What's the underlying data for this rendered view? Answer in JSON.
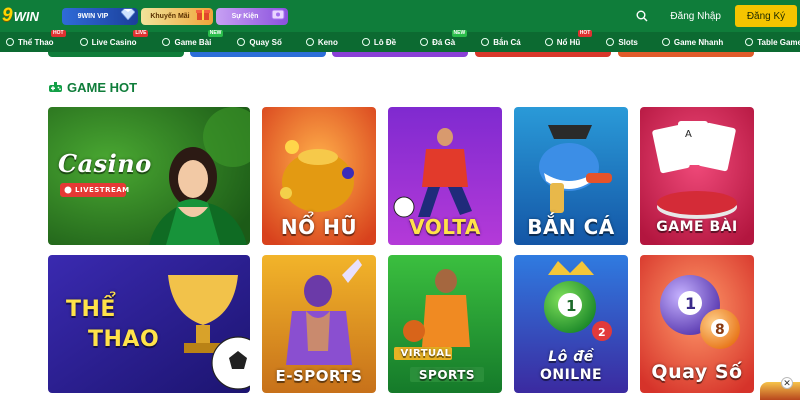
{
  "brand": {
    "logo_number": "9",
    "logo_word": "WIN"
  },
  "promos": [
    {
      "label": "9WIN VIP",
      "icon": "diamond-icon",
      "color": "#2f6bd8"
    },
    {
      "label": "Khuyến Mãi",
      "icon": "gift-icon",
      "color": "#f0a53a"
    },
    {
      "label": "Sự Kiện",
      "icon": "ticket-icon",
      "color": "#8a50dd"
    }
  ],
  "header": {
    "login_label": "Đăng Nhập",
    "register_label": "Đăng Ký",
    "accent": "#f5c400",
    "bar_color": "#0f7d3a"
  },
  "nav": [
    {
      "label": "Thể Thao",
      "tag": "HOT"
    },
    {
      "label": "Live Casino",
      "tag": "LIVE"
    },
    {
      "label": "Game Bài",
      "tag": "NEW"
    },
    {
      "label": "Quay Số",
      "tag": ""
    },
    {
      "label": "Keno",
      "tag": ""
    },
    {
      "label": "Lô Đề",
      "tag": ""
    },
    {
      "label": "Đá Gà",
      "tag": "NEW"
    },
    {
      "label": "Bắn Cá",
      "tag": ""
    },
    {
      "label": "Nổ Hũ",
      "tag": "HOT"
    },
    {
      "label": "Slots",
      "tag": ""
    },
    {
      "label": "Game Nhanh",
      "tag": ""
    },
    {
      "label": "Table Games",
      "tag": ""
    }
  ],
  "section": {
    "title": "GAME HOT"
  },
  "games": [
    {
      "title": "Casino",
      "badge": "LIVESTREAM"
    },
    {
      "title": "NỔ HŨ"
    },
    {
      "title": "VOLTA"
    },
    {
      "title": "BẮN CÁ"
    },
    {
      "title": "GAME BÀI"
    },
    {
      "title_line1": "THỂ",
      "title_line2": "THAO"
    },
    {
      "title": "E-SPORTS"
    },
    {
      "title_line1": "VIRTUAL",
      "title_line2": "SPORTS"
    },
    {
      "title_line1": "Lô đề",
      "title_line2": "ONILNE"
    },
    {
      "title": "Quay Số"
    }
  ]
}
